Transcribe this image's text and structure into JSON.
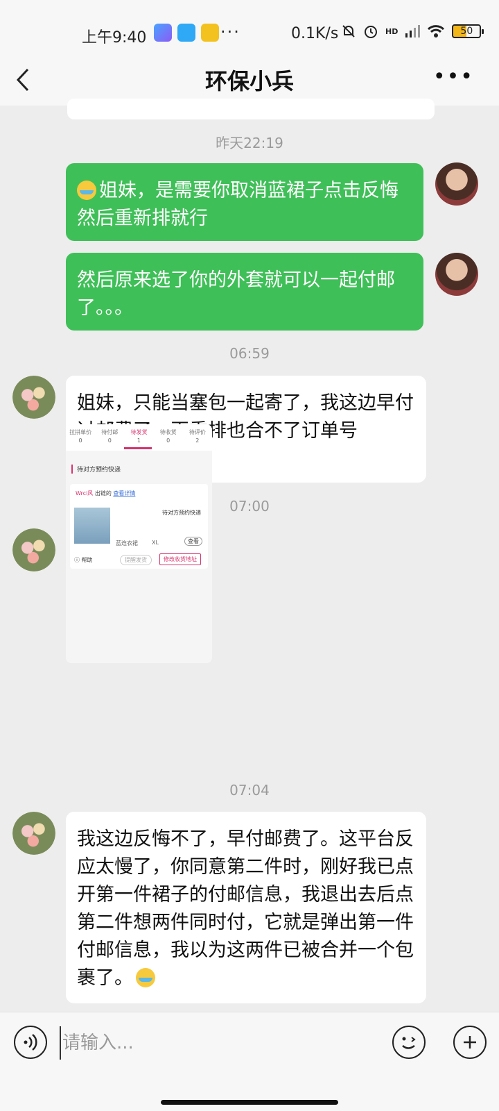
{
  "status_bar": {
    "time": "上午9:40",
    "network_speed": "0.1K/s",
    "signal_label": "HD",
    "battery": "50",
    "more": "···"
  },
  "header": {
    "title": "环保小兵"
  },
  "messages": [
    {
      "timestamp": "昨天22:19"
    },
    {
      "sender": "me",
      "text": "姐妹，是需要你取消蓝裙子点击反悔然后重新排就行"
    },
    {
      "sender": "me",
      "text": "然后原来选了你的外套就可以一起付邮了。。。"
    },
    {
      "timestamp": "06:59"
    },
    {
      "sender": "other",
      "text": "姐妹，只能当塞包一起寄了，我这边早付过邮费了。再重排也合不了订单号"
    },
    {
      "timestamp": "07:00"
    },
    {
      "sender": "other",
      "type": "image"
    },
    {
      "timestamp": "07:04"
    },
    {
      "sender": "other",
      "text": "我这边反悔不了，早付邮费了。这平台反应太慢了，你同意第二件时，刚好我已点开第一件裙子的付邮信息，我退出去后点第二件想两件同时付，它就是弹出第一件付邮信息，我以为这两件已被合并一个包裹了。"
    }
  ],
  "screenshot": {
    "tabs": [
      {
        "label": "拉拼单价",
        "count": "0"
      },
      {
        "label": "待付邮",
        "count": "0"
      },
      {
        "label": "待发货",
        "count": "1"
      },
      {
        "label": "待收货",
        "count": "0"
      },
      {
        "label": "待评价",
        "count": "2"
      }
    ],
    "status_heading": "待对方预约快递",
    "shop_name": "Wrci风",
    "shop_suffix": "出链的",
    "view_details": "查看详情",
    "order_state": "待对方预约快递",
    "spec": "蓝连衣裙",
    "size": "XL",
    "view": "查看",
    "help": "帮助",
    "remind": "提醒发货",
    "modify": "修改收货地址"
  },
  "input": {
    "placeholder": "请输入..."
  }
}
